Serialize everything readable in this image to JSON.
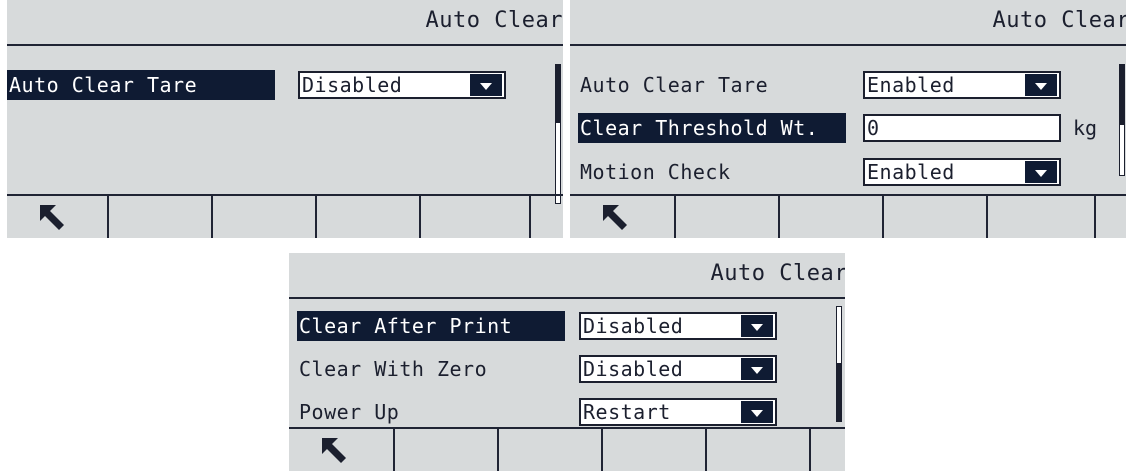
{
  "screen1": {
    "title": "Auto Clear",
    "rows": [
      {
        "label": "Auto Clear Tare",
        "value": "Disabled"
      }
    ]
  },
  "screen2": {
    "title": "Auto Clear",
    "rows": [
      {
        "label": "Auto Clear Tare",
        "value": "Enabled"
      },
      {
        "label": "Clear Threshold Wt.",
        "value": "0",
        "unit": "kg"
      },
      {
        "label": "Motion Check",
        "value": "Enabled"
      }
    ]
  },
  "screen3": {
    "title": "Auto Clear",
    "rows": [
      {
        "label": "Clear After Print",
        "value": "Disabled"
      },
      {
        "label": "Clear With Zero",
        "value": "Disabled"
      },
      {
        "label": "Power Up",
        "value": "Restart"
      }
    ]
  },
  "icons": {
    "softkey_1": "up-left-arrow-icon"
  }
}
